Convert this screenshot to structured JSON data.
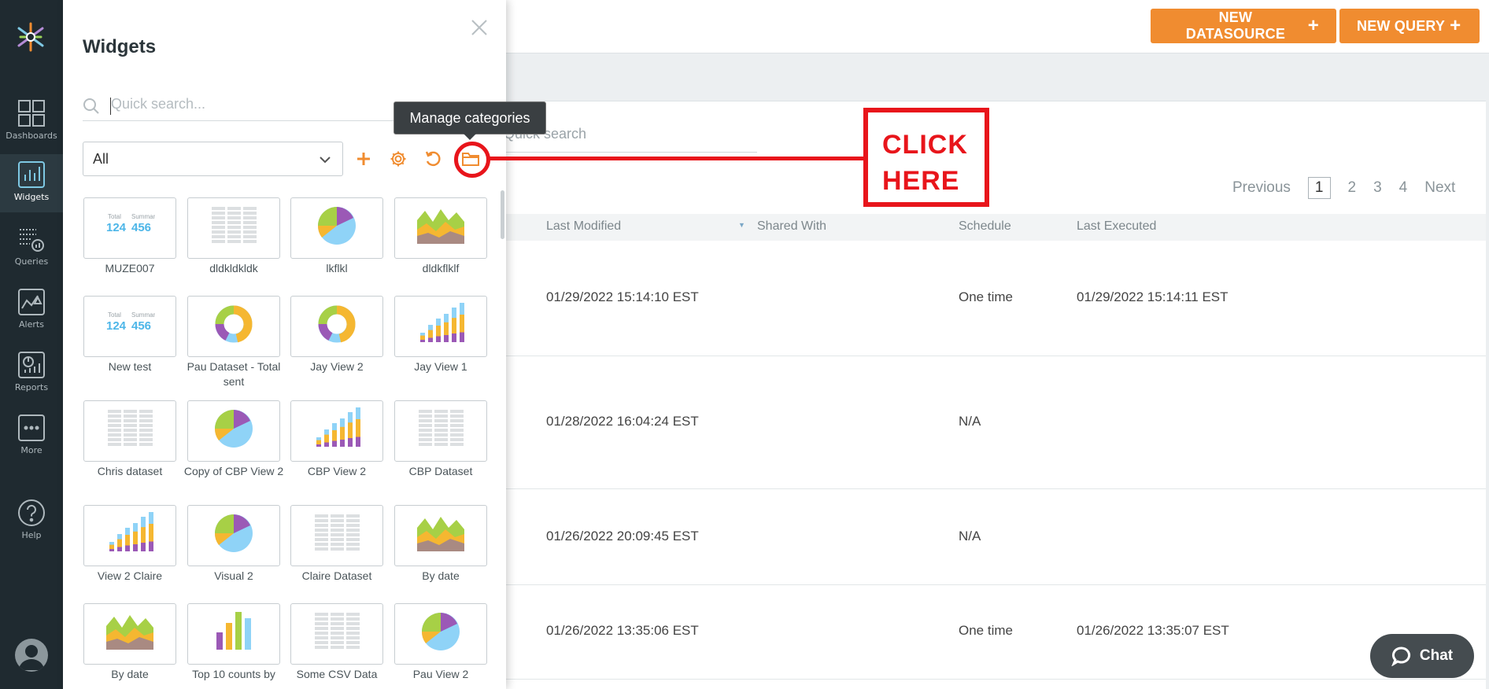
{
  "nav": {
    "items": [
      {
        "label": "Dashboards",
        "icon": "dashboards-icon"
      },
      {
        "label": "Widgets",
        "icon": "widgets-icon"
      },
      {
        "label": "Queries",
        "icon": "queries-icon"
      },
      {
        "label": "Alerts",
        "icon": "alerts-icon"
      },
      {
        "label": "Reports",
        "icon": "reports-icon"
      },
      {
        "label": "More",
        "icon": "more-icon"
      },
      {
        "label": "Help",
        "icon": "help-icon"
      }
    ],
    "active": "Widgets"
  },
  "topbar": {
    "new_datasource": "NEW DATASOURCE",
    "new_query": "NEW QUERY",
    "accent": "#f08c30"
  },
  "main": {
    "search_placeholder": "Quick search",
    "pager": {
      "previous": "Previous",
      "pages": [
        "1",
        "2",
        "3",
        "4"
      ],
      "next": "Next",
      "current": "1"
    },
    "columns": [
      "Last Modified",
      "Shared With",
      "Schedule",
      "Last Executed"
    ],
    "rows": [
      {
        "last_modified": "01/29/2022 15:14:10 EST",
        "shared_with": "",
        "schedule": "One time",
        "last_executed": "01/29/2022 15:14:11 EST"
      },
      {
        "last_modified": "01/28/2022 16:04:24 EST",
        "shared_with": "",
        "schedule": "N/A",
        "last_executed": ""
      },
      {
        "last_modified": "01/26/2022 20:09:45 EST",
        "shared_with": "",
        "schedule": "N/A",
        "last_executed": ""
      },
      {
        "last_modified": "01/26/2022 13:35:06 EST",
        "shared_with": "",
        "schedule": "One time",
        "last_executed": "01/26/2022 13:35:07 EST"
      }
    ]
  },
  "flyout": {
    "title": "Widgets",
    "search_placeholder": "Quick search...",
    "category": "All",
    "tooltip": "Manage categories",
    "widgets": [
      {
        "label": "MUZE007",
        "type": "summary"
      },
      {
        "label": "dldkldkldk",
        "type": "table"
      },
      {
        "label": "lkflkl",
        "type": "pie"
      },
      {
        "label": "dldkflklf",
        "type": "area"
      },
      {
        "label": "New test",
        "type": "summary"
      },
      {
        "label": "Pau Dataset - Total sent",
        "type": "donut"
      },
      {
        "label": "Jay View 2",
        "type": "donut"
      },
      {
        "label": "Jay View 1",
        "type": "stacked-bar"
      },
      {
        "label": "Chris dataset",
        "type": "table"
      },
      {
        "label": "Copy of CBP View 2",
        "type": "pie"
      },
      {
        "label": "CBP View 2",
        "type": "stacked-bar"
      },
      {
        "label": "CBP Dataset",
        "type": "table"
      },
      {
        "label": "View 2 Claire",
        "type": "stacked-bar"
      },
      {
        "label": "Visual 2",
        "type": "pie"
      },
      {
        "label": "Claire Dataset",
        "type": "table"
      },
      {
        "label": "By date",
        "type": "area"
      },
      {
        "label": "By date",
        "type": "area"
      },
      {
        "label": "Top 10 counts by",
        "type": "bar"
      },
      {
        "label": "Some CSV Data",
        "type": "table"
      },
      {
        "label": "Pau View 2",
        "type": "pie"
      }
    ],
    "summary_card": {
      "left_label": "Total",
      "left_value": "124",
      "right_label": "Summary",
      "right_value": "456"
    }
  },
  "annotation": {
    "line1": "CLICK",
    "line2": "HERE",
    "color": "#e8151b"
  },
  "chat": {
    "label": "Chat"
  }
}
